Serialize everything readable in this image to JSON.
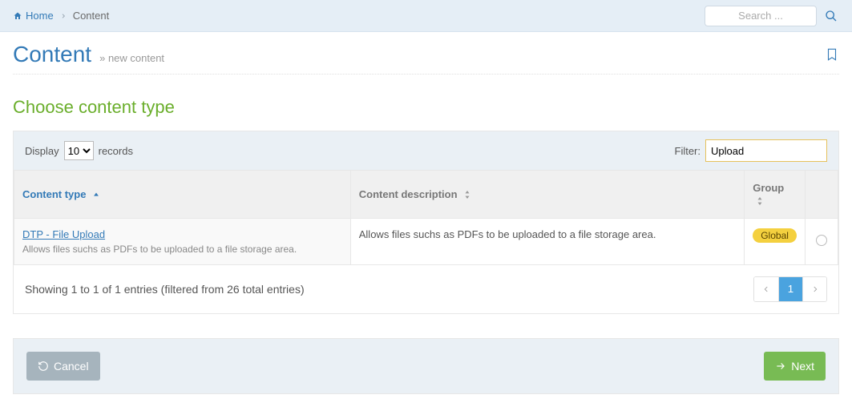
{
  "breadcrumbs": {
    "home": "Home",
    "current": "Content"
  },
  "search": {
    "placeholder": "Search ..."
  },
  "page": {
    "title": "Content",
    "new_link": "new content"
  },
  "section": {
    "title": "Choose content type"
  },
  "records": {
    "display_label": "Display",
    "per_page": "10",
    "records_label": "records"
  },
  "filter": {
    "label": "Filter:",
    "value": "Upload"
  },
  "columns": {
    "type": "Content type",
    "description": "Content description",
    "group": "Group"
  },
  "row": {
    "title": "DTP - File Upload",
    "subtitle": "Allows files suchs as PDFs to be uploaded to a file storage area.",
    "description": "Allows files suchs as PDFs to be uploaded to a file storage area.",
    "group": "Global"
  },
  "summary": "Showing 1 to 1 of 1 entries (filtered from 26 total entries)",
  "pager": {
    "page": "1"
  },
  "buttons": {
    "cancel": "Cancel",
    "next": "Next"
  }
}
